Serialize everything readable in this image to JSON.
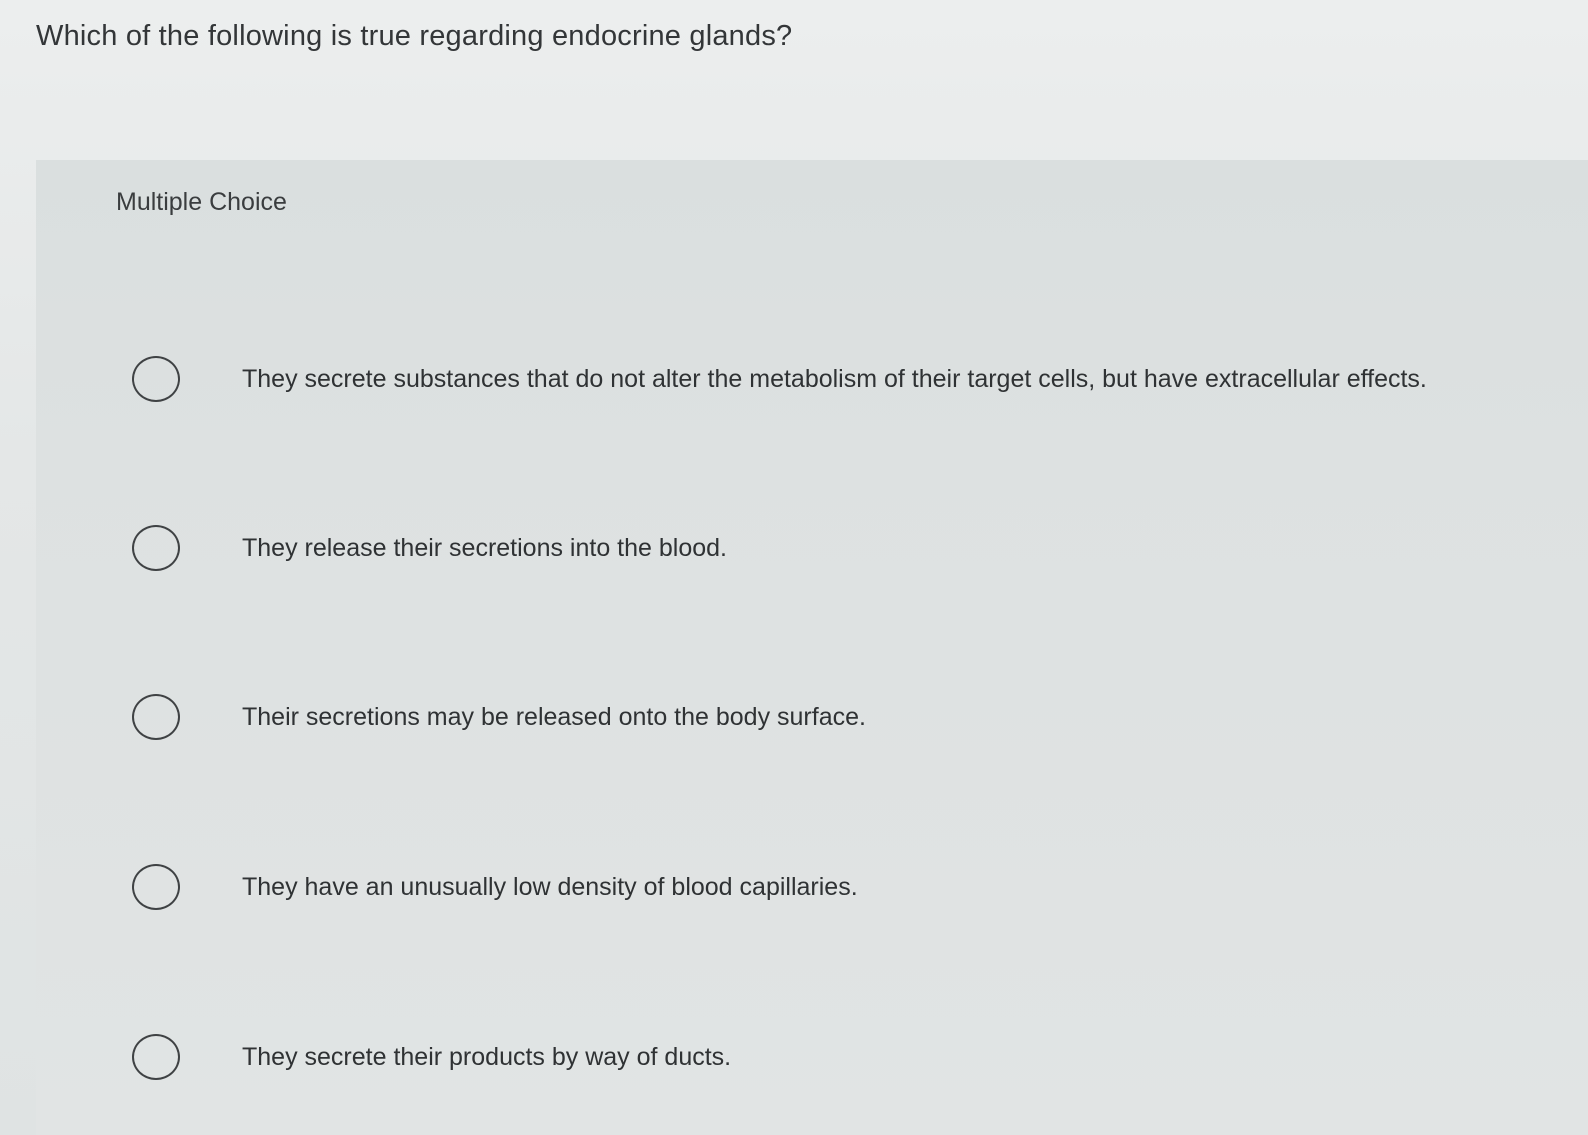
{
  "question": {
    "text": "Which of the following is true regarding endocrine glands?"
  },
  "panel": {
    "type_label": "Multiple Choice"
  },
  "options": [
    {
      "label": "They secrete substances that do not alter the metabolism of their target cells, but have extracellular effects."
    },
    {
      "label": "They release their secretions into the blood."
    },
    {
      "label": "Their secretions may be released onto the body surface."
    },
    {
      "label": "They have an unusually low density of blood capillaries."
    },
    {
      "label": "They secrete their products by way of ducts."
    }
  ]
}
